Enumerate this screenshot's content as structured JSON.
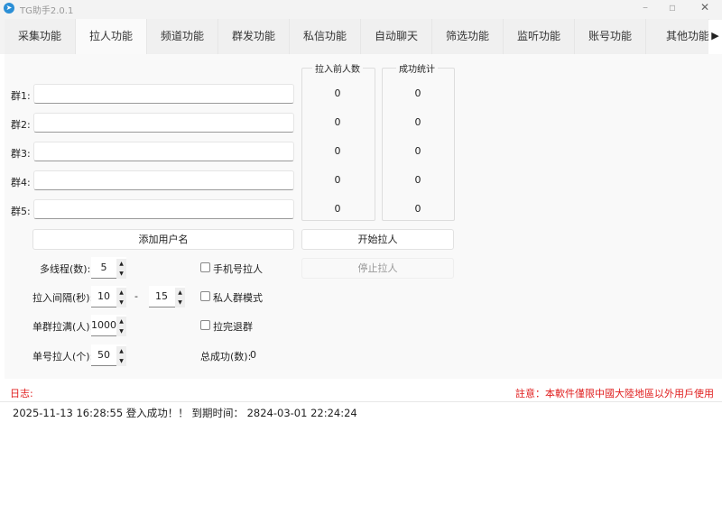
{
  "window": {
    "title": "TG助手2.0.1",
    "icon": "telegram-icon"
  },
  "tabs": [
    "采集功能",
    "拉人功能",
    "频道功能",
    "群发功能",
    "私信功能",
    "自动聊天",
    "筛选功能",
    "监听功能",
    "账号功能",
    "其他功能"
  ],
  "selected_tab": "拉人功能",
  "groups": [
    {
      "label": "群1:",
      "value": "",
      "before": "0",
      "success": "0"
    },
    {
      "label": "群2:",
      "value": "",
      "before": "0",
      "success": "0"
    },
    {
      "label": "群3:",
      "value": "",
      "before": "0",
      "success": "0"
    },
    {
      "label": "群4:",
      "value": "",
      "before": "0",
      "success": "0"
    },
    {
      "label": "群5:",
      "value": "",
      "before": "0",
      "success": "0"
    }
  ],
  "headers": {
    "before": "拉入前人数",
    "success": "成功统计"
  },
  "buttons": {
    "add_username": "添加用户名",
    "start": "开始拉人",
    "stop": "停止拉人"
  },
  "settings": {
    "threads_label": "多线程(数):",
    "threads": "5",
    "interval_label": "拉入间隔(秒):",
    "interval_min": "10",
    "dash": "-",
    "interval_max": "15",
    "group_full_label": "单群拉满(人):",
    "group_full": "1000",
    "per_account_label": "单号拉人(个):",
    "per_account": "50"
  },
  "checkboxes": [
    {
      "label": "手机号拉人",
      "checked": false
    },
    {
      "label": "私人群模式",
      "checked": false
    },
    {
      "label": "拉完退群",
      "checked": false
    }
  ],
  "total": {
    "label": "总成功(数):",
    "value": "0"
  },
  "log": {
    "label": "日志:",
    "notice": "註意：本軟件僅限中國大陸地區以外用戶使用",
    "lines": [
      "2025-11-13 16:28:55 登入成功！！ 到期时间： 2824-03-01 22:24:24"
    ],
    "notice_color": "#e02020"
  }
}
